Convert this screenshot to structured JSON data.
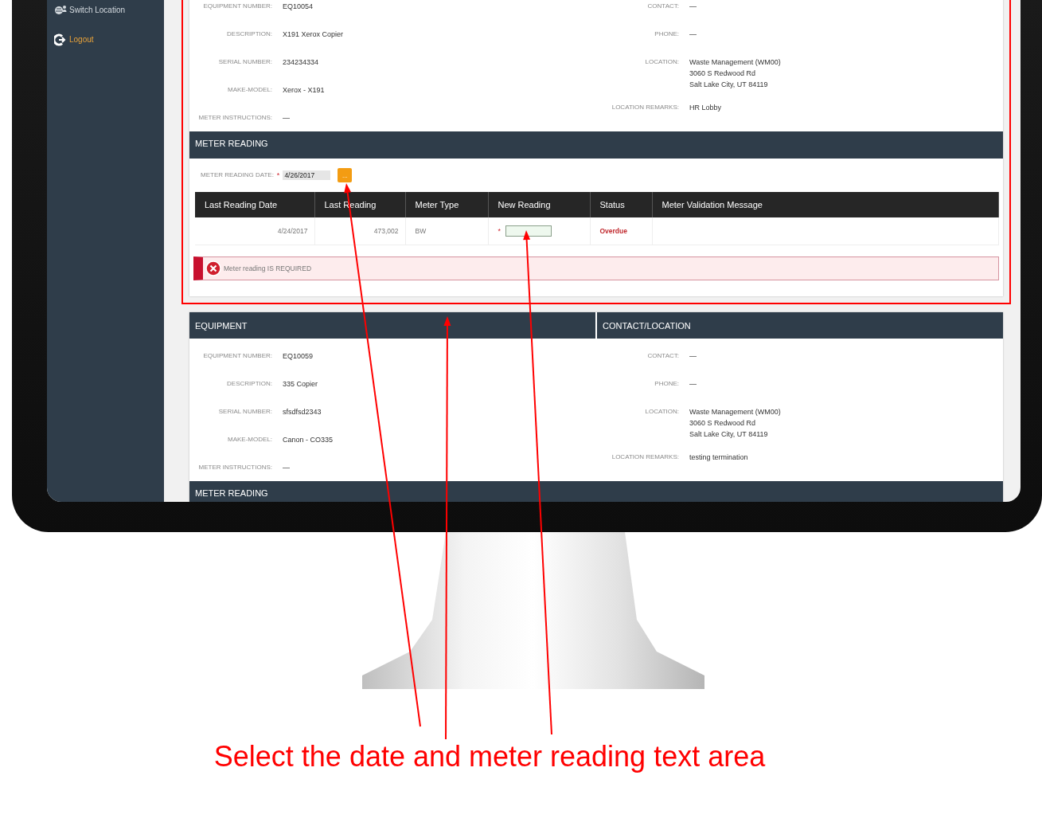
{
  "sidebar": {
    "items": [
      {
        "label": "Switch Location",
        "kind": "switch",
        "highlighted": false
      },
      {
        "label": "Logout",
        "kind": "logout",
        "highlighted": true
      }
    ]
  },
  "cards": [
    {
      "highlighted": true,
      "equipment": {
        "fields": [
          {
            "label": "EQUIPMENT NUMBER:",
            "value": [
              "EQ10054"
            ]
          },
          {
            "label": "DESCRIPTION:",
            "value": [
              "X191 Xerox Copier"
            ]
          },
          {
            "label": "SERIAL NUMBER:",
            "value": [
              "234234334"
            ]
          },
          {
            "label": "MAKE-MODEL:",
            "value": [
              "Xerox - X191"
            ]
          },
          {
            "label": "METER INSTRUCTIONS:",
            "value": [
              "—"
            ]
          }
        ]
      },
      "contact": {
        "fields": [
          {
            "label": "CONTACT:",
            "value": [
              "—"
            ]
          },
          {
            "label": "PHONE:",
            "value": [
              "—"
            ]
          },
          {
            "label": "LOCATION:",
            "value": [
              "Waste Management (WM00)",
              "3060 S Redwood Rd",
              "Salt Lake City, UT 84119"
            ]
          },
          {
            "label": "LOCATION REMARKS:",
            "value": [
              "HR Lobby"
            ]
          }
        ]
      },
      "meter_reading": {
        "title": "METER READING",
        "date_label": "METER READING DATE:",
        "required_mark": "*",
        "date_value": "4/26/2017",
        "picker_label": "...",
        "columns": [
          "Last Reading Date",
          "Last Reading",
          "Meter Type",
          "New Reading",
          "Status",
          "Meter Validation Message"
        ],
        "rows": [
          {
            "last_reading_date": "4/24/2017",
            "last_reading": "473,002",
            "meter_type": "BW",
            "new_reading": {
              "required_mark": "*",
              "invalid": true
            },
            "status": "Overdue",
            "status_overdue": true
          }
        ],
        "error": "Meter reading IS REQUIRED"
      }
    },
    {
      "highlighted": false,
      "equipment": {
        "title": "EQUIPMENT",
        "fields": [
          {
            "label": "EQUIPMENT NUMBER:",
            "value": [
              "EQ10059"
            ]
          },
          {
            "label": "DESCRIPTION:",
            "value": [
              "335 Copier"
            ]
          },
          {
            "label": "SERIAL NUMBER:",
            "value": [
              "sfsdfsd2343"
            ]
          },
          {
            "label": "MAKE-MODEL:",
            "value": [
              "Canon - CO335"
            ]
          },
          {
            "label": "METER INSTRUCTIONS:",
            "value": [
              "—"
            ]
          }
        ]
      },
      "contact": {
        "title": "CONTACT/LOCATION",
        "fields": [
          {
            "label": "CONTACT:",
            "value": [
              "—"
            ]
          },
          {
            "label": "PHONE:",
            "value": [
              "—"
            ]
          },
          {
            "label": "LOCATION:",
            "value": [
              "Waste Management (WM00)",
              "3060 S Redwood Rd",
              "Salt Lake City, UT 84119"
            ]
          },
          {
            "label": "LOCATION REMARKS:",
            "value": [
              "testing termination"
            ]
          }
        ]
      },
      "meter_reading": {
        "title": "METER READING"
      }
    }
  ],
  "annotation": {
    "caption": "Select the date and meter reading text area"
  }
}
